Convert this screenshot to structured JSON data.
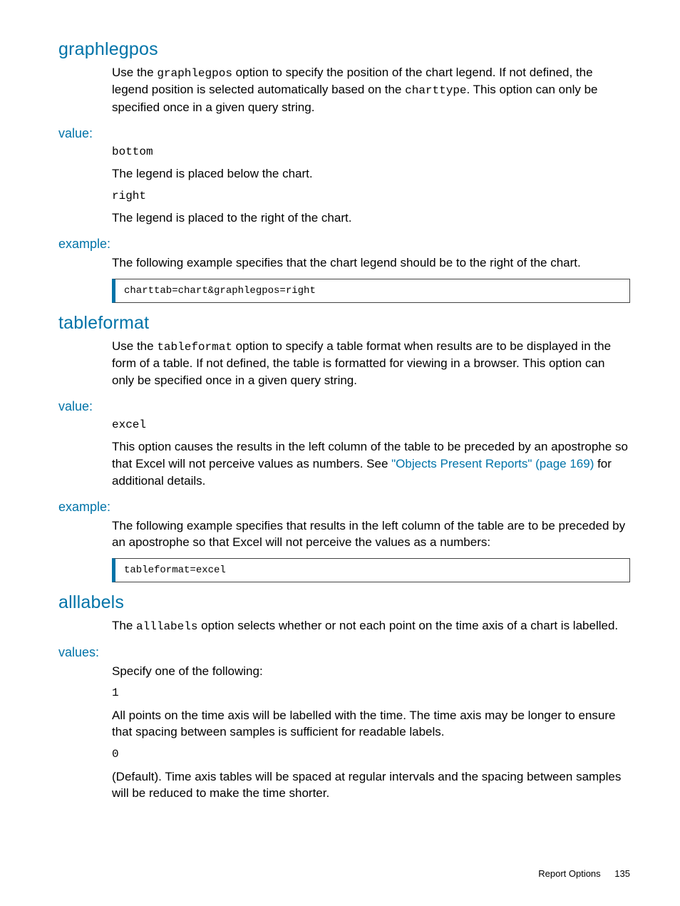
{
  "sections": [
    {
      "title": "graphlegpos",
      "intro": {
        "pre": "Use the ",
        "code1": "graphlegpos",
        "mid": " option to specify the position of the chart legend. If not defined, the legend position is selected automatically based on the ",
        "code2": "charttype",
        "post": ". This option can only be specified once in a given query string."
      },
      "value_label": "value:",
      "values": [
        {
          "code": "bottom",
          "desc": "The legend is placed below the chart."
        },
        {
          "code": "right",
          "desc": "The legend is placed to the right of the chart."
        }
      ],
      "example_label": "example:",
      "example_intro": "The following example specifies that the chart legend should be to the right of the chart.",
      "example_code": "charttab=chart&graphlegpos=right"
    },
    {
      "title": "tableformat",
      "intro": {
        "pre": "Use the ",
        "code1": "tableformat",
        "mid": " option to specify a table format when results are to be displayed in the form of a table. If not defined, the table is formatted for viewing in a browser. This option can only be specified once in a given query string.",
        "code2": "",
        "post": ""
      },
      "value_label": "value:",
      "values": [
        {
          "code": "excel",
          "desc_pre": "This option causes the results in the left column of the table to be preceded by an apostrophe so that Excel will not perceive values as numbers. See ",
          "link": "\"Objects Present Reports\" (page 169)",
          "desc_post": " for additional details."
        }
      ],
      "example_label": "example:",
      "example_intro": "The following example specifies that results in the left column of the table are to be preceded by an apostrophe so that Excel will not perceive the values as a numbers:",
      "example_code": "tableformat=excel"
    },
    {
      "title": "alllabels",
      "intro": {
        "pre": "The ",
        "code1": "alllabels",
        "mid": " option selects whether or not each point on the time axis of a chart is labelled.",
        "code2": "",
        "post": ""
      },
      "value_label": "values:",
      "values_intro": "Specify one of the following:",
      "values": [
        {
          "code": "1",
          "desc": "All points on the time axis will be labelled with the time. The time axis may be longer to ensure that spacing between samples is sufficient for readable labels."
        },
        {
          "code": "0",
          "desc": "(Default). Time axis tables will be spaced at regular intervals and the spacing between samples will be reduced to make the time shorter."
        }
      ]
    }
  ],
  "footer": {
    "label": "Report Options",
    "page": "135"
  }
}
